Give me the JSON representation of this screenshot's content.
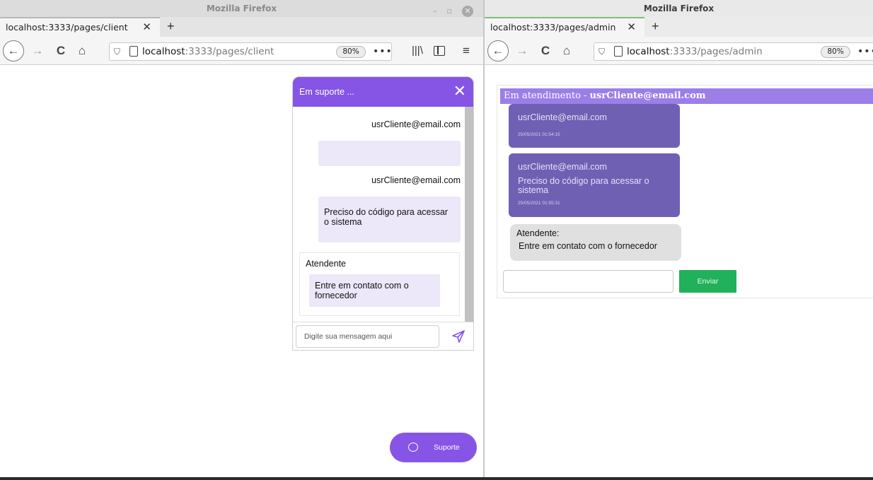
{
  "left_window": {
    "title": "Mozilla Firefox",
    "tab_label": "localhost:3333/pages/client",
    "url_host": "localhost",
    "url_path": ":3333/pages/client",
    "zoom": "80%"
  },
  "right_window": {
    "title": "Mozilla Firefox",
    "tab_label": "localhost:3333/pages/admin",
    "url_host": "localhost",
    "url_path": ":3333/pages/admin",
    "zoom": "80%"
  },
  "browser": {
    "tab_close_glyph": "✕",
    "new_tab_glyph": "+",
    "back_glyph": "←",
    "forward_glyph": "→",
    "reload_glyph": "C",
    "home_glyph": "⌂",
    "shield_glyph": "⛉",
    "overflow_glyph": "•••",
    "library_glyph": "|||\\",
    "menu_glyph": "≡",
    "minimize_glyph": "–",
    "restore_glyph": "▫",
    "close_glyph": "✕"
  },
  "client_chat": {
    "header": "Em suporte ...",
    "close_glyph": "✕",
    "messages": [
      {
        "sender": "usrCliente@email.com",
        "text": ""
      },
      {
        "sender": "usrCliente@email.com",
        "text": "Preciso do código para acessar o sistema"
      }
    ],
    "agent_message": {
      "sender": "Atendente",
      "text": "Entre em contato com o fornecedor"
    },
    "input_placeholder": "Digite sua mensagem aqui",
    "accent_color": "#8655e6",
    "bubble_color": "#ede7fa"
  },
  "support_button": {
    "label": "Suporte"
  },
  "admin": {
    "header_prefix": "Em atendimento -",
    "header_email": "usrCliente@email.com",
    "messages": [
      {
        "sender": "usrCliente@email.com",
        "text": "",
        "timestamp": "25/05/2021 01:54:15"
      },
      {
        "sender": "usrCliente@email.com",
        "text": "Preciso do código para acessar o sistema",
        "timestamp": "25/05/2021 01:55:31"
      }
    ],
    "reply": {
      "sender": "Atendente:",
      "text": "Entre em contato com o fornecedor"
    },
    "send_label": "Enviar",
    "accent_color": "#9b7ee8",
    "message_color": "#7060b4",
    "send_color": "#21b15a"
  }
}
